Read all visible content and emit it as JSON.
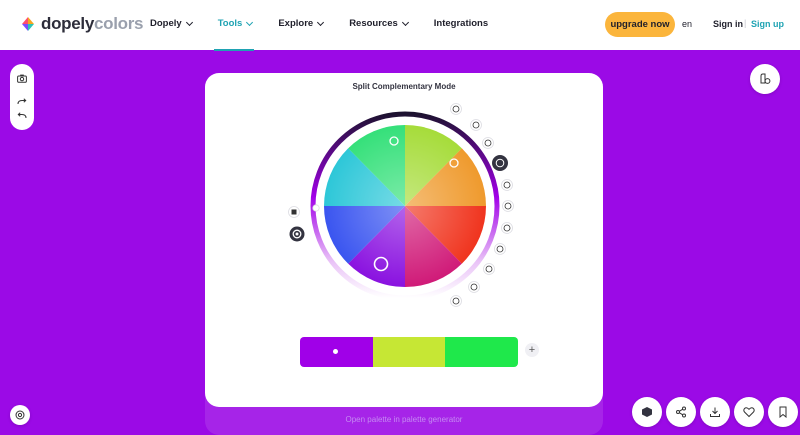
{
  "header": {
    "logo_part1": "dopely",
    "logo_part2": "colors",
    "nav": [
      {
        "label": "Dopely",
        "active": false
      },
      {
        "label": "Tools",
        "active": true
      },
      {
        "label": "Explore",
        "active": false
      },
      {
        "label": "Resources",
        "active": false
      },
      {
        "label": "Integrations",
        "active": false
      }
    ],
    "upgrade_label": "upgrade now",
    "lang": "en",
    "signin": "Sign in",
    "separator": "|",
    "signup": "Sign up"
  },
  "card": {
    "mode_title": "Split Complementary Mode",
    "open_link": "Open palette in palette generator",
    "plus_label": "+"
  },
  "palette": {
    "swatches": [
      "#a000e8",
      "#c6e734",
      "#1fe84b"
    ]
  },
  "colors": {
    "background": "#9b0ae6",
    "accent": "#1fa3b3",
    "upgrade": "#fbb53c"
  },
  "icons": {
    "left_tools": [
      "camera-icon",
      "redo-icon",
      "undo-icon"
    ],
    "bottom_left": "settings-icon",
    "top_right": "color-blind-icon",
    "bottom_bar": [
      "cube-icon",
      "share-icon",
      "download-icon",
      "heart-icon",
      "bookmark-icon"
    ]
  }
}
